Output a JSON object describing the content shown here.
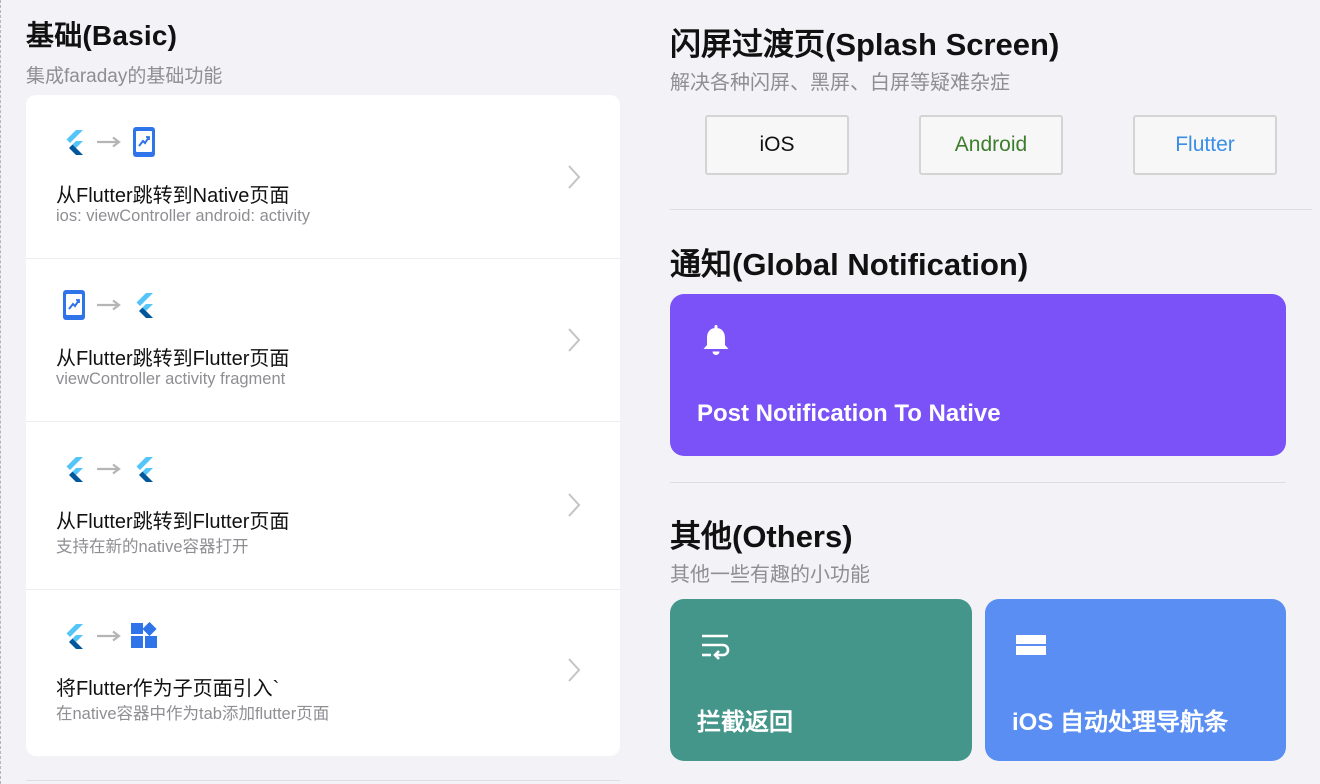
{
  "basic": {
    "title": "基础(Basic)",
    "subtitle": "集成faraday的基础功能",
    "items": [
      {
        "title": "从Flutter跳转到Native页面",
        "desc": "ios: viewController android: activity",
        "icons": [
          "flutter-icon",
          "arrow-right-icon",
          "native-page-icon"
        ]
      },
      {
        "title": "从Flutter跳转到Flutter页面",
        "desc": "viewController activity fragment",
        "icons": [
          "native-page-icon",
          "arrow-right-icon",
          "flutter-icon"
        ]
      },
      {
        "title": "从Flutter跳转到Flutter页面",
        "desc": "支持在新的native容器打开",
        "icons": [
          "flutter-icon",
          "arrow-right-icon",
          "flutter-icon"
        ]
      },
      {
        "title": "将Flutter作为子页面引入`",
        "desc": "在native容器中作为tab添加flutter页面",
        "icons": [
          "flutter-icon",
          "arrow-right-icon",
          "widgets-icon"
        ]
      }
    ]
  },
  "splash": {
    "title": "闪屏过渡页(Splash Screen)",
    "subtitle": "解决各种闪屏、黑屏、白屏等疑难杂症",
    "buttons": [
      {
        "label": "iOS",
        "color": "#111111"
      },
      {
        "label": "Android",
        "color": "#3d7e2e"
      },
      {
        "label": "Flutter",
        "color": "#3a8ee6"
      }
    ]
  },
  "notification": {
    "title": "通知(Global Notification)",
    "card_label": "Post Notification To Native",
    "card_icon": "bell-icon",
    "card_color": "#7b52f7"
  },
  "others": {
    "title": "其他(Others)",
    "subtitle": "其他一些有趣的小功能",
    "cards": [
      {
        "label": "拦截返回",
        "icon": "wrap-text-icon",
        "color": "#45968a"
      },
      {
        "label": "iOS 自动处理导航条",
        "icon": "nav-bar-icon",
        "color": "#5a8ef3"
      }
    ]
  }
}
